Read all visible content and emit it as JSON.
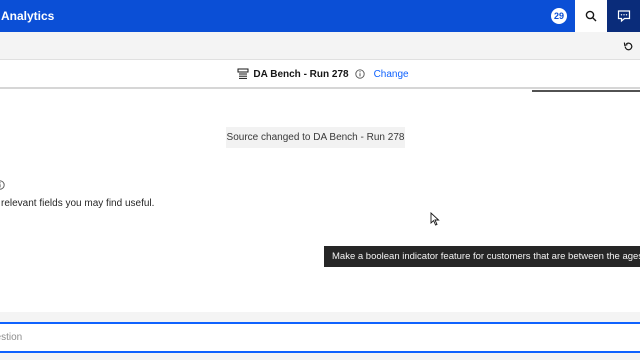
{
  "header": {
    "app_title": "Analytics",
    "notification_count": "29",
    "search_icon": "search-icon",
    "chat_icon": "chat-icon"
  },
  "toolbar": {
    "refresh_icon": "refresh-icon"
  },
  "source": {
    "name": "DA Bench - Run 278",
    "change_label": "Change"
  },
  "chat": {
    "notice": "Source changed to DA Bench - Run 278",
    "message": "relevant fields you may find useful.",
    "tooltip": "Make a boolean indicator feature for customers that are between the ages"
  },
  "input": {
    "placeholder": "uestion"
  },
  "colors": {
    "header_bg": "#0b4fd6",
    "accent": "#0f62fe",
    "tooltip_bg": "#262626"
  }
}
